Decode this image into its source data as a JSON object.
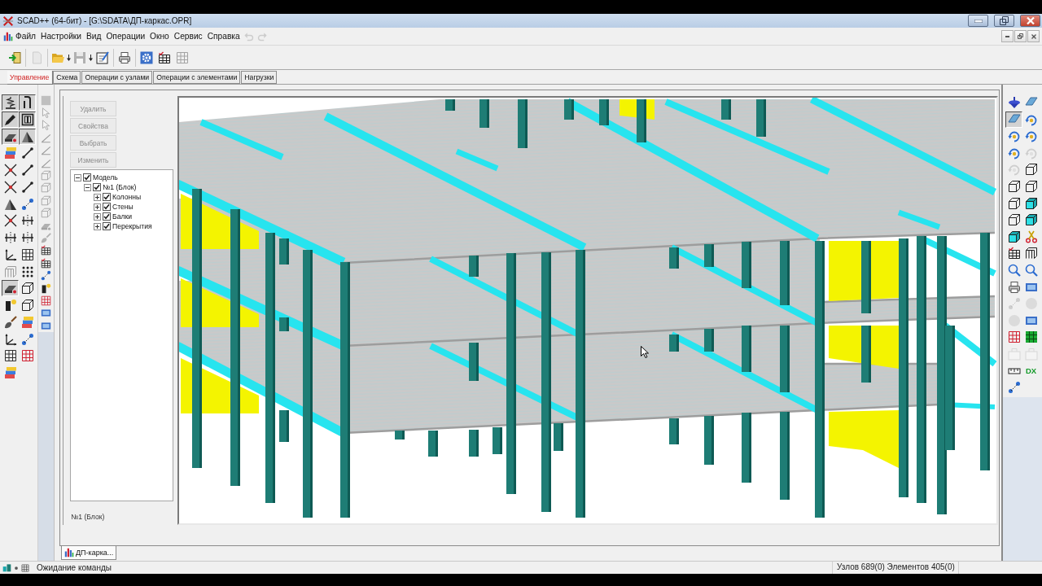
{
  "window": {
    "title": "SCAD++ (64-бит) - [G:\\SDATA\\ДП-каркас.OPR]"
  },
  "menu": {
    "items": [
      "Файл",
      "Настройки",
      "Вид",
      "Операции",
      "Окно",
      "Сервис",
      "Справка"
    ],
    "undo": {
      "disabled": true
    },
    "redo": {
      "disabled": true
    }
  },
  "toolbar": {
    "groups": [
      [
        {
          "disabled": false,
          "dropdown": false
        }
      ],
      [
        {
          "disabled": true,
          "dropdown": false
        }
      ],
      [
        {
          "disabled": false,
          "dropdown": true
        },
        {
          "disabled": true,
          "dropdown": true
        },
        {
          "disabled": false,
          "dropdown": false
        }
      ],
      [
        {
          "disabled": false,
          "dropdown": false
        }
      ],
      [
        {
          "disabled": false,
          "dropdown": false
        },
        {
          "disabled": false,
          "dropdown": false
        },
        {
          "disabled": true,
          "dropdown": false
        }
      ]
    ]
  },
  "tabs": [
    {
      "label": "Управление",
      "selected": true
    },
    {
      "label": "Схема",
      "selected": false
    },
    {
      "label": "Операции с узлами",
      "selected": false
    },
    {
      "label": "Операции с элементами",
      "selected": false
    },
    {
      "label": "Нагрузки",
      "selected": false
    }
  ],
  "left_toolbar": {
    "buttons": [
      {
        "pressed": true,
        "disabled": false
      },
      {
        "pressed": true,
        "disabled": false
      },
      {
        "pressed": true,
        "disabled": false
      },
      {
        "pressed": true,
        "disabled": false
      },
      {
        "pressed": true,
        "disabled": false
      },
      {
        "pressed": true,
        "disabled": false
      },
      {
        "pressed": false,
        "disabled": false
      },
      {
        "pressed": false,
        "disabled": false
      },
      {
        "pressed": false,
        "disabled": false
      },
      {
        "pressed": false,
        "disabled": false
      },
      {
        "pressed": false,
        "disabled": false
      },
      {
        "pressed": false,
        "disabled": false
      },
      {
        "pressed": false,
        "disabled": false
      },
      {
        "pressed": false,
        "disabled": false
      },
      {
        "pressed": false,
        "disabled": false
      },
      {
        "pressed": false,
        "disabled": false
      },
      {
        "pressed": false,
        "disabled": false
      },
      {
        "pressed": false,
        "disabled": false
      },
      {
        "pressed": false,
        "disabled": false
      },
      {
        "pressed": false,
        "disabled": false
      },
      {
        "pressed": false,
        "disabled": true
      },
      {
        "pressed": false,
        "disabled": false
      },
      {
        "pressed": true,
        "disabled": false
      },
      {
        "pressed": false,
        "disabled": false
      },
      {
        "pressed": false,
        "disabled": false
      },
      {
        "pressed": false,
        "disabled": false
      },
      {
        "pressed": false,
        "disabled": false
      },
      {
        "pressed": false,
        "disabled": false
      },
      {
        "pressed": false,
        "disabled": false
      },
      {
        "pressed": false,
        "disabled": false
      },
      {
        "pressed": false,
        "disabled": false
      },
      {
        "pressed": false,
        "disabled": false
      },
      {
        "pressed": false,
        "disabled": false
      }
    ]
  },
  "filter_toolbar": {
    "buttons": [
      {
        "disabled": true
      },
      {
        "disabled": true
      },
      {
        "disabled": true
      },
      {
        "disabled": true
      },
      {
        "disabled": true
      },
      {
        "disabled": true
      },
      {
        "disabled": true
      },
      {
        "disabled": true
      },
      {
        "disabled": true
      },
      {
        "disabled": true
      },
      {
        "disabled": true
      },
      {
        "disabled": true
      },
      {
        "disabled": false
      },
      {
        "disabled": false
      },
      {
        "disabled": false
      },
      {
        "disabled": false
      },
      {
        "disabled": false
      },
      {
        "disabled": false
      },
      {
        "disabled": false
      }
    ]
  },
  "tree_panel": {
    "buttons": [
      {
        "label": "Удалить",
        "disabled": true
      },
      {
        "label": "Свойства",
        "disabled": true
      },
      {
        "label": "Выбрать",
        "disabled": true
      },
      {
        "label": "Изменить",
        "disabled": true
      }
    ],
    "tree": [
      {
        "label": "Модель",
        "checked": true,
        "expanded": true,
        "children": [
          {
            "label": "№1 (Блок)",
            "checked": true,
            "expanded": true,
            "children": [
              {
                "label": "Колонны",
                "checked": true,
                "expanded": false
              },
              {
                "label": "Стены",
                "checked": true,
                "expanded": false
              },
              {
                "label": "Балки",
                "checked": true,
                "expanded": false
              },
              {
                "label": "Перекрытия",
                "checked": true,
                "expanded": false
              }
            ]
          }
        ]
      }
    ],
    "footer": "№1 (Блок)"
  },
  "right_toolbar": {
    "buttons": [
      {
        "kind": "icon",
        "pressed": false,
        "disabled": false
      },
      {
        "kind": "icon",
        "pressed": false,
        "disabled": false
      },
      {
        "kind": "icon",
        "pressed": true,
        "disabled": false
      },
      {
        "kind": "icon",
        "pressed": false,
        "disabled": false
      },
      {
        "kind": "icon",
        "pressed": false,
        "disabled": false
      },
      {
        "kind": "icon",
        "pressed": false,
        "disabled": false
      },
      {
        "kind": "icon",
        "pressed": false,
        "disabled": false
      },
      {
        "kind": "icon",
        "pressed": false,
        "disabled": true
      },
      {
        "kind": "icon",
        "pressed": false,
        "disabled": true
      },
      {
        "kind": "icon",
        "pressed": false,
        "disabled": false
      },
      {
        "kind": "icon",
        "pressed": false,
        "disabled": false
      },
      {
        "kind": "icon",
        "pressed": false,
        "disabled": false
      },
      {
        "kind": "icon",
        "pressed": false,
        "disabled": false
      },
      {
        "kind": "icon",
        "pressed": false,
        "disabled": false
      },
      {
        "kind": "icon",
        "pressed": false,
        "disabled": false
      },
      {
        "kind": "icon",
        "pressed": false,
        "disabled": false
      },
      {
        "kind": "icon",
        "pressed": false,
        "disabled": false
      },
      {
        "kind": "icon",
        "pressed": false,
        "disabled": false
      },
      {
        "kind": "icon",
        "pressed": false,
        "disabled": false
      },
      {
        "kind": "icon",
        "pressed": false,
        "disabled": false
      },
      {
        "kind": "icon",
        "pressed": false,
        "disabled": false
      },
      {
        "kind": "icon",
        "pressed": false,
        "disabled": false
      },
      {
        "kind": "icon",
        "pressed": false,
        "disabled": false
      },
      {
        "kind": "icon",
        "pressed": false,
        "disabled": false
      },
      {
        "kind": "icon",
        "pressed": false,
        "disabled": true
      },
      {
        "kind": "icon",
        "pressed": false,
        "disabled": true
      },
      {
        "kind": "icon",
        "pressed": false,
        "disabled": true
      },
      {
        "kind": "icon",
        "pressed": false,
        "disabled": false
      },
      {
        "kind": "icon",
        "pressed": false,
        "disabled": false
      },
      {
        "kind": "icon",
        "pressed": false,
        "disabled": false
      },
      {
        "kind": "icon",
        "pressed": false,
        "disabled": true
      },
      {
        "kind": "icon",
        "pressed": false,
        "disabled": true
      },
      {
        "kind": "icon",
        "pressed": false,
        "disabled": false
      },
      {
        "kind": "label",
        "label": "DX",
        "pressed": false,
        "disabled": false
      },
      {
        "kind": "icon",
        "pressed": false,
        "disabled": false
      }
    ]
  },
  "document_tabs": [
    {
      "label": "ДП-карка...",
      "selected": true
    }
  ],
  "status_bar": {
    "message": "Ожидание команды",
    "counts": "Узлов 689(0) Элементов 405(0)"
  }
}
